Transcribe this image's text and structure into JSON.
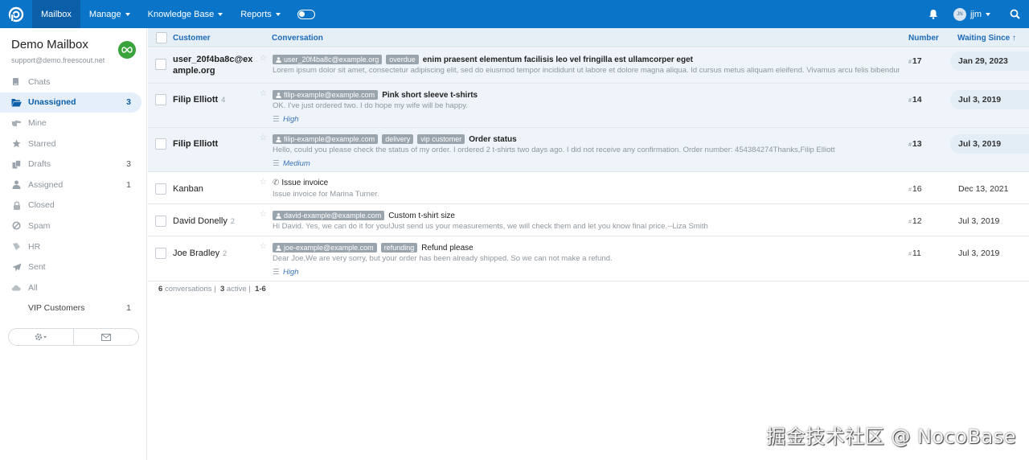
{
  "nav": {
    "items": [
      {
        "label": "Mailbox",
        "active": true,
        "caret": false
      },
      {
        "label": "Manage",
        "active": false,
        "caret": true
      },
      {
        "label": "Knowledge Base",
        "active": false,
        "caret": true
      },
      {
        "label": "Reports",
        "active": false,
        "caret": true
      }
    ],
    "user": {
      "initials": "JN",
      "name": "jjm"
    }
  },
  "sidebar": {
    "mailbox_name": "Demo Mailbox",
    "mailbox_email": "support@demo.freescout.net",
    "folders": [
      {
        "label": "Chats",
        "count": "",
        "icon": "chat-icon",
        "active": false
      },
      {
        "label": "Unassigned",
        "count": "3",
        "icon": "folder-open-icon",
        "active": true
      },
      {
        "label": "Mine",
        "count": "",
        "icon": "hand-pointing-icon",
        "active": false
      },
      {
        "label": "Starred",
        "count": "",
        "icon": "star-icon",
        "active": false
      },
      {
        "label": "Drafts",
        "count": "3",
        "icon": "drafts-icon",
        "active": false
      },
      {
        "label": "Assigned",
        "count": "1",
        "icon": "user-icon",
        "active": false
      },
      {
        "label": "Closed",
        "count": "",
        "icon": "lock-icon",
        "active": false
      },
      {
        "label": "Spam",
        "count": "",
        "icon": "ban-icon",
        "active": false
      },
      {
        "label": "HR",
        "count": "",
        "icon": "filter-icon",
        "active": false
      },
      {
        "label": "Sent",
        "count": "",
        "icon": "send-icon",
        "active": false
      },
      {
        "label": "All",
        "count": "",
        "icon": "cloud-icon",
        "active": false
      },
      {
        "label": "VIP Customers",
        "count": "1",
        "icon": "",
        "active": false
      }
    ]
  },
  "table": {
    "headers": {
      "customer": "Customer",
      "conversation": "Conversation",
      "number": "Number",
      "waiting": "Waiting Since ↑"
    },
    "rows": [
      {
        "customer": "user_20f4ba8c@example.org",
        "count": "",
        "email_tag": "user_20f4ba8c@example.org",
        "tags": [
          "overdue"
        ],
        "subject": "enim praesent elementum facilisis leo vel fringilla est ullamcorper eget",
        "preview": "Lorem ipsum dolor sit amet, consectetur adipiscing elit, sed do eiusmod tempor incididunt ut labore et dolore magna aliqua. Id cursus metus aliquam eleifend. Vivamus arcu felis bibendum",
        "priority": "",
        "number": "17",
        "waiting": "Jan 29, 2023",
        "unread": true,
        "phone": false
      },
      {
        "customer": "Filip Elliott",
        "count": "4",
        "email_tag": "filip-example@example.com",
        "tags": [],
        "subject": "Pink short sleeve t-shirts",
        "preview": "OK. I've just ordered two. I do hope my wife will be happy.",
        "priority": "High",
        "number": "14",
        "waiting": "Jul 3, 2019",
        "unread": true,
        "phone": false
      },
      {
        "customer": "Filip Elliott",
        "count": "",
        "email_tag": "filip-example@example.com",
        "tags": [
          "delivery",
          "vip customer"
        ],
        "subject": "Order status",
        "preview": "Hello, could you please check the status of my order. I ordered 2 t-shirts two days ago. I did not receive any confirmation. Order number: 454384274Thanks,Filip Elliott",
        "priority": "Medium",
        "number": "13",
        "waiting": "Jul 3, 2019",
        "unread": true,
        "phone": false
      },
      {
        "customer": "Kanban",
        "count": "",
        "email_tag": "",
        "tags": [],
        "subject": "Issue invoice",
        "preview": "Issue invoice for Marina Turner.",
        "priority": "",
        "number": "16",
        "waiting": "Dec 13, 2021",
        "unread": false,
        "phone": true
      },
      {
        "customer": "David Donelly",
        "count": "2",
        "email_tag": "david-example@example.com",
        "tags": [],
        "subject": "Custom t-shirt size",
        "preview": "Hi David. Yes, we can do it for you!Just send us your measurements, we will check them and let you know final price.--Liza Smith",
        "priority": "",
        "number": "12",
        "waiting": "Jul 3, 2019",
        "unread": false,
        "phone": false
      },
      {
        "customer": "Joe Bradley",
        "count": "2",
        "email_tag": "joe-example@example.com",
        "tags": [
          "refunding"
        ],
        "subject": "Refund please",
        "preview": "Dear Joe,We are very sorry, but your order has been already shipped. So we can not make a refund.",
        "priority": "High",
        "number": "11",
        "waiting": "Jul 3, 2019",
        "unread": false,
        "phone": false
      }
    ]
  },
  "footer": {
    "conversations_count": "6",
    "conversations_label": "conversations |",
    "active_count": "3",
    "active_label": "active |",
    "range": "1-6"
  },
  "watermark": "掘金技术社区 @ NocoBase",
  "colors": {
    "brand": "#0a74c9",
    "nav_active": "#0b5fa8",
    "tag": "#9aa4ad",
    "link": "#1e6bb8",
    "mailbox_badge": "#3aa33b"
  }
}
